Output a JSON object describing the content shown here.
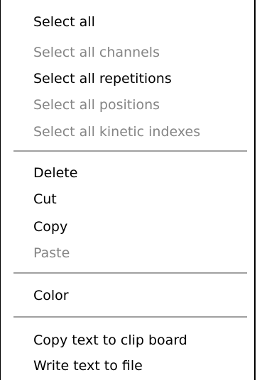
{
  "menu": {
    "items": [
      {
        "label": "Select all",
        "enabled": true
      },
      {
        "label": "Select all channels",
        "enabled": false
      },
      {
        "label": "Select all repetitions",
        "enabled": true
      },
      {
        "label": "Select all positions",
        "enabled": false
      },
      {
        "label": "Select all kinetic indexes",
        "enabled": false
      },
      {
        "label": "Delete",
        "enabled": true
      },
      {
        "label": "Cut",
        "enabled": true
      },
      {
        "label": "Copy",
        "enabled": true
      },
      {
        "label": "Paste",
        "enabled": false
      },
      {
        "label": "Color",
        "enabled": true
      },
      {
        "label": "Copy text to clip board",
        "enabled": true
      },
      {
        "label": "Write text to file",
        "enabled": true
      }
    ]
  },
  "colors": {
    "text": "#000000",
    "disabled_text": "#858585",
    "separator": "#a0a0a0",
    "background": "#ffffff"
  }
}
